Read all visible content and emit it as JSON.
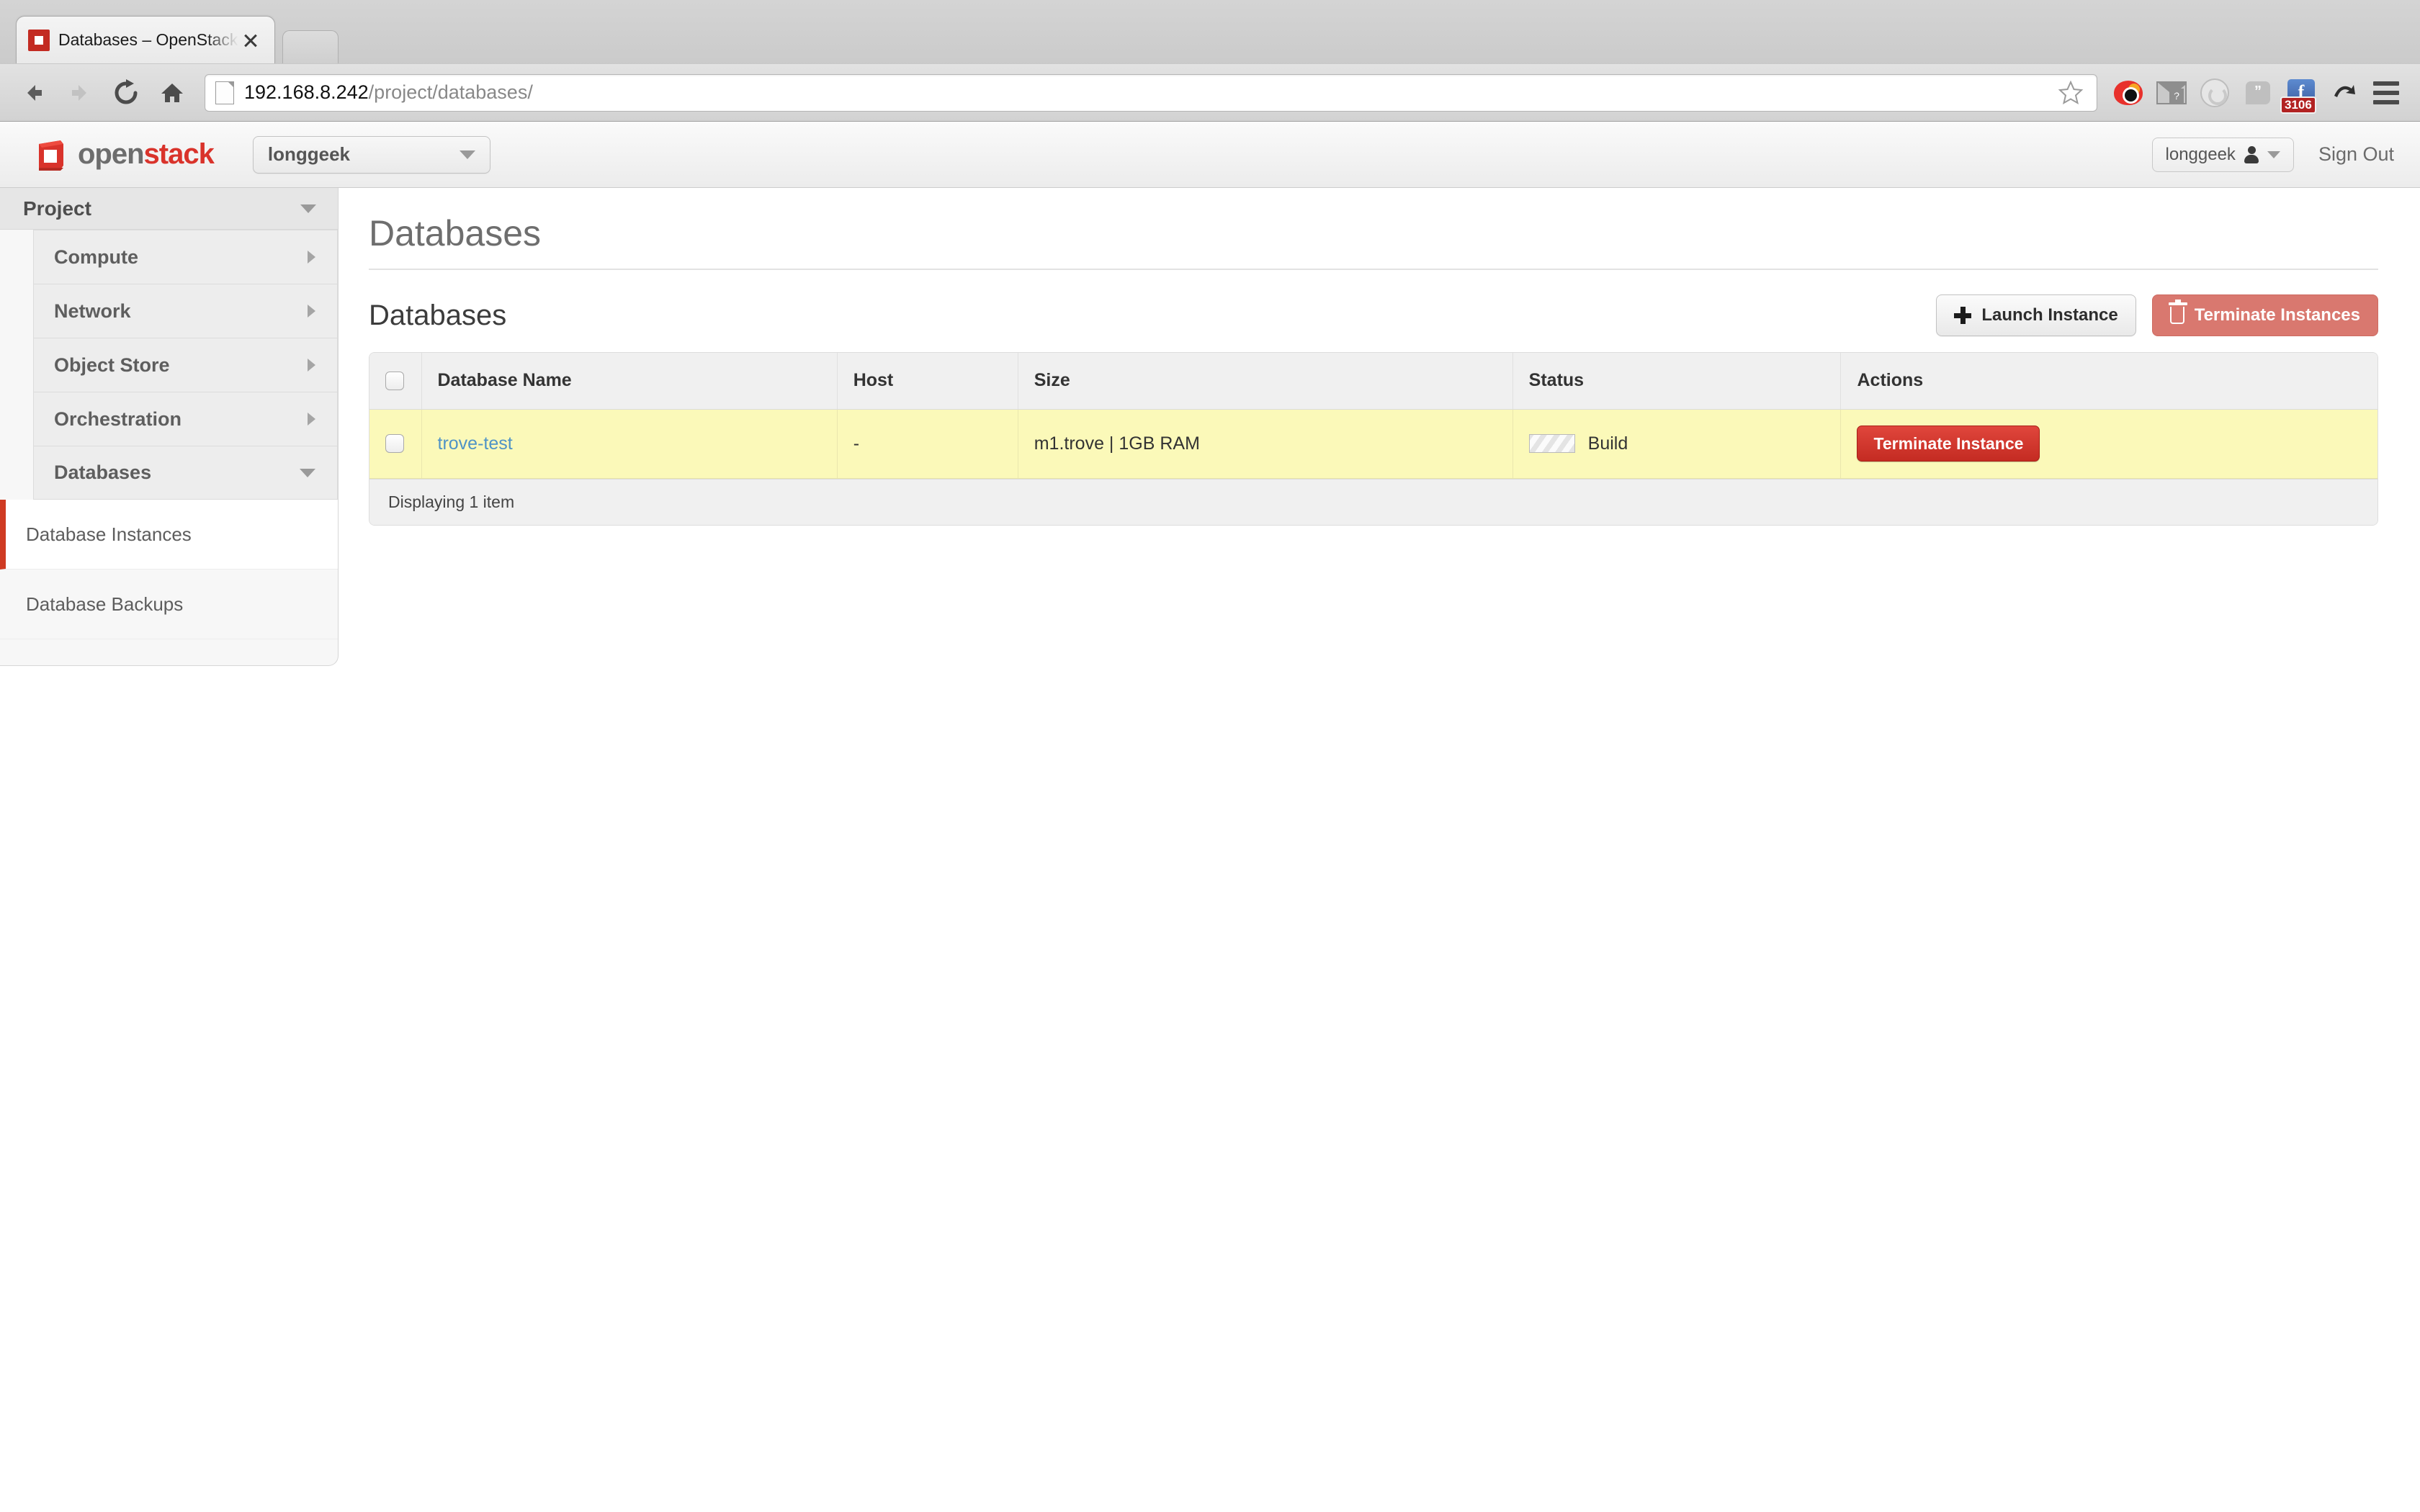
{
  "browser": {
    "tab": {
      "title": "Databases – OpenStack Da",
      "favicon_name": "openstack-favicon",
      "close_label": "×"
    },
    "newtab_label": "",
    "nav": {
      "back": "Back",
      "forward": "Forward",
      "reload": "Reload",
      "home": "Home"
    },
    "url": {
      "host": "192.168.8.242",
      "path": "/project/databases/",
      "page_icon": "page-icon",
      "bookmark_icon": "star-icon"
    },
    "extensions": [
      {
        "name": "weibo-extension-icon",
        "label": ""
      },
      {
        "name": "gmail-extension-icon",
        "label": "?"
      },
      {
        "name": "sync-extension-icon",
        "label": ""
      },
      {
        "name": "hangouts-extension-icon",
        "label": "”"
      },
      {
        "name": "facebook-extension-icon",
        "label": "f",
        "badge": "3106"
      },
      {
        "name": "arrow-extension-icon",
        "label": ""
      }
    ],
    "menu_label": "Chrome menu"
  },
  "header": {
    "logo": {
      "open": "open",
      "stack": "stack"
    },
    "project_selector": {
      "value": "longgeek"
    },
    "user_menu": {
      "name": "longgeek"
    },
    "sign_out": "Sign Out"
  },
  "sidebar": {
    "panel_title": "Project",
    "groups": [
      {
        "label": "Compute",
        "expanded": false
      },
      {
        "label": "Network",
        "expanded": false
      },
      {
        "label": "Object Store",
        "expanded": false
      },
      {
        "label": "Orchestration",
        "expanded": false
      },
      {
        "label": "Databases",
        "expanded": true
      }
    ],
    "sub_items": [
      {
        "label": "Database Instances",
        "active": true
      },
      {
        "label": "Database Backups",
        "active": false
      }
    ]
  },
  "main": {
    "page_title": "Databases",
    "panel_title": "Databases",
    "actions": {
      "launch_instance": "Launch Instance",
      "terminate_instances": "Terminate Instances"
    },
    "table": {
      "columns": [
        "",
        "Database Name",
        "Host",
        "Size",
        "Status",
        "Actions"
      ],
      "rows": [
        {
          "name": "trove-test",
          "host": "-",
          "size": "m1.trove | 1GB RAM",
          "status": "Build",
          "action": "Terminate Instance",
          "highlighted": true
        }
      ],
      "footer": "Displaying 1 item"
    }
  },
  "colors": {
    "brand_red": "#d9332b",
    "active_marker": "#cf3a22",
    "row_highlight": "#fbf9b9",
    "link": "#4f93c6",
    "danger": "#c42b22"
  }
}
